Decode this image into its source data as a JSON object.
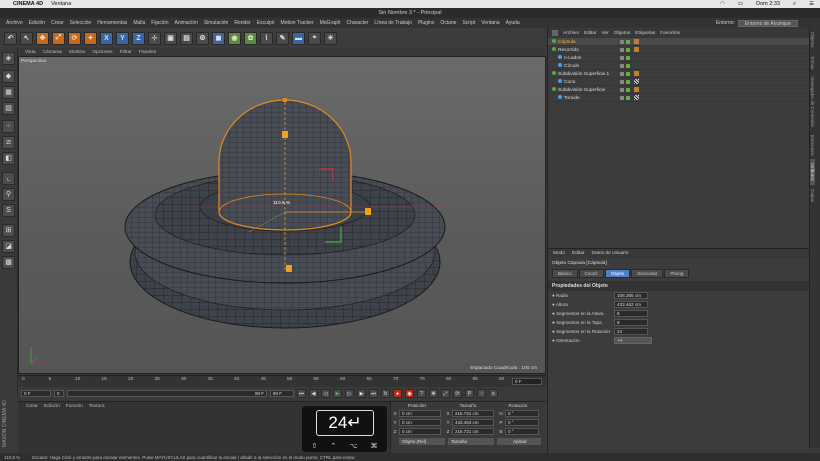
{
  "mac_menu": {
    "app": "CINEMA 4D",
    "window": "Ventana",
    "clock": "Dom 2:33"
  },
  "window_title": "Sin Nombre 3 * - Principal",
  "main_menu": [
    "Archivo",
    "Edición",
    "Crear",
    "Selección",
    "Herramientas",
    "Malla",
    "Fijación",
    "Animación",
    "Simulación",
    "Render",
    "Esculpir",
    "Motion Tracker",
    "MoGraph",
    "Character",
    "Línea de Trabajo",
    "Plugins",
    "Octane",
    "Script",
    "Ventana",
    "Ayuda"
  ],
  "environment": {
    "label": "Entorno:",
    "value": "Entorno de Arranque"
  },
  "toolbar_axes": [
    "X",
    "Y",
    "Z"
  ],
  "viewport_menu": [
    "Vista",
    "Cámaras",
    "Mostrar",
    "Opciones",
    "Filtrar",
    "Paneles"
  ],
  "viewport": {
    "label": "Perspectiva",
    "grid_spacing": "Espaciado Cuadrícula : 100 cm",
    "scale_readout": "110.6 %"
  },
  "timeline": {
    "ticks": [
      "0",
      "5",
      "10",
      "15",
      "20",
      "25",
      "30",
      "35",
      "40",
      "45",
      "50",
      "55",
      "60",
      "65",
      "70",
      "75",
      "80",
      "85",
      "90"
    ],
    "frame": "0 F"
  },
  "playback": {
    "start": "0 F",
    "current": "0",
    "end": "90 F",
    "end2": "90 F"
  },
  "material_menu": [
    "Crear",
    "Edición",
    "Función",
    "Textura"
  ],
  "brand": "MAXON CINEMA 4D",
  "coords": {
    "headers": [
      "Posición",
      "Tamaño",
      "Rotación"
    ],
    "rows": [
      {
        "axis": "X",
        "pos": "0 cm",
        "size_axis": "X",
        "size": "216.731 cm",
        "rot_axis": "H",
        "rot": "0 °"
      },
      {
        "axis": "Y",
        "pos": "0 cm",
        "size_axis": "Y",
        "size": "433.463 cm",
        "rot_axis": "P",
        "rot": "0 °"
      },
      {
        "axis": "Z",
        "pos": "0 cm",
        "size_axis": "Z",
        "size": "216.731 cm",
        "rot_axis": "B",
        "rot": "0 °"
      }
    ],
    "mode": "Objeto (Rel)",
    "size_mode": "Tamaño",
    "apply": "Aplicar"
  },
  "status": {
    "zoom": "110.6 %",
    "message": "Escalar: Haga Click y arrastre para escalar elementos. Pulse MAYÚSCULAS para cuantificar la escala / añadir a la selección en el modo punto, CTRL para restar."
  },
  "objects_menu": [
    "Archivo",
    "Editar",
    "Ver",
    "Objetos",
    "Etiquetas",
    "Favoritos"
  ],
  "objects": [
    {
      "name": "Cápsula",
      "indent": 0,
      "selected": true,
      "dot": "#4caf50"
    },
    {
      "name": "Recorrido",
      "indent": 0,
      "selected": false,
      "dot": "#4caf50"
    },
    {
      "name": "n-Lados",
      "indent": 1,
      "selected": false,
      "dot": "#4aa0e0"
    },
    {
      "name": "Círculo",
      "indent": 1,
      "selected": false,
      "dot": "#4aa0e0"
    },
    {
      "name": "Subdivisión Superficie.1",
      "indent": 0,
      "selected": false,
      "dot": "#4caf50"
    },
    {
      "name": "Cono",
      "indent": 1,
      "selected": false,
      "dot": "#4aa0e0"
    },
    {
      "name": "Subdivisión Superficie",
      "indent": 0,
      "selected": false,
      "dot": "#4caf50"
    },
    {
      "name": "Toroide",
      "indent": 1,
      "selected": false,
      "dot": "#4aa0e0"
    }
  ],
  "side_tabs": [
    "Objetos",
    "Tomas",
    "Navegador de Contenido",
    "Estructura",
    "Atributos",
    "Capas"
  ],
  "attributes": {
    "menu": [
      "Modo",
      "Editar",
      "Datos de Usuario"
    ],
    "title": "Objeto Cápsula [Cápsula]",
    "tabs": [
      "Básico",
      "Coord.",
      "Objeto",
      "Seccionar",
      "Phong"
    ],
    "active_tab": "Objeto",
    "section": "Propiedades del Objeto",
    "fields": [
      {
        "label": "Radio",
        "value": "108.365 cm"
      },
      {
        "label": "Altura",
        "value": "433.462 cm"
      },
      {
        "label": "Segmentos en la Altura",
        "value": "8"
      },
      {
        "label": "Segmentos en la Tapa",
        "value": "8"
      },
      {
        "label": "Segmentos en la Rotación",
        "value": "24"
      },
      {
        "label": "Orientación",
        "value": "+Y",
        "dropdown": true
      }
    ]
  },
  "key_overlay": {
    "number": "24",
    "keys": [
      "⇧",
      "⌃",
      "⌥",
      "⌘"
    ]
  }
}
